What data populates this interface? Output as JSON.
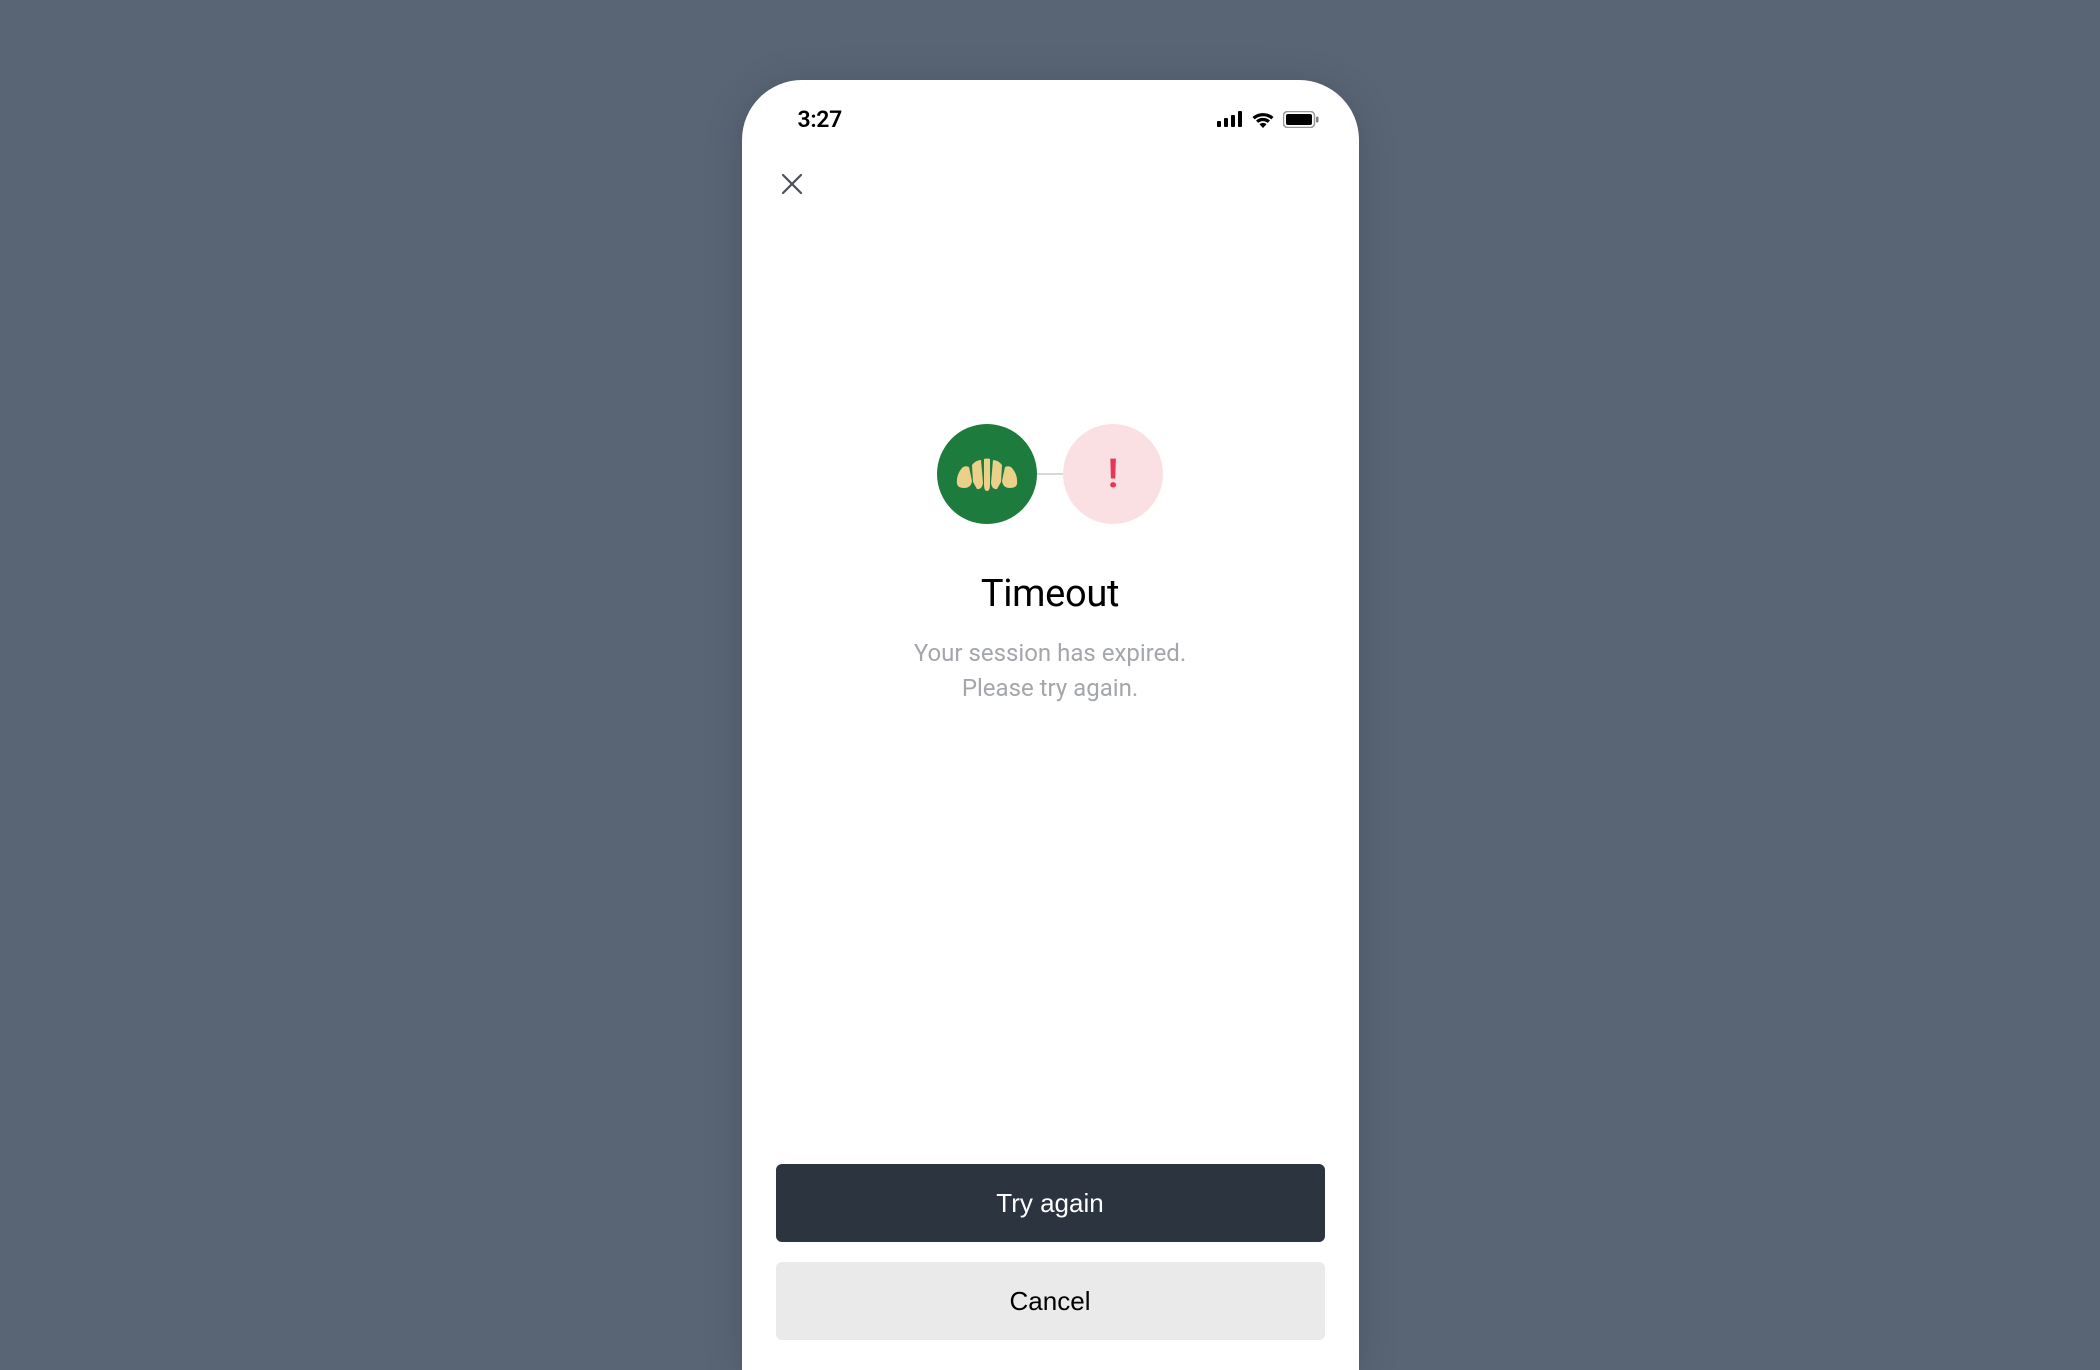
{
  "status_bar": {
    "time": "3:27"
  },
  "content": {
    "title": "Timeout",
    "subtitle_line1": "Your session has expired.",
    "subtitle_line2": "Please try again."
  },
  "buttons": {
    "primary": "Try again",
    "secondary": "Cancel"
  },
  "colors": {
    "background": "#596575",
    "logo_bg": "#1e7b3e",
    "error_bg": "#fbe0e3",
    "error_fg": "#e63757",
    "primary_btn": "#2c3440",
    "secondary_btn": "#eaeaea"
  }
}
